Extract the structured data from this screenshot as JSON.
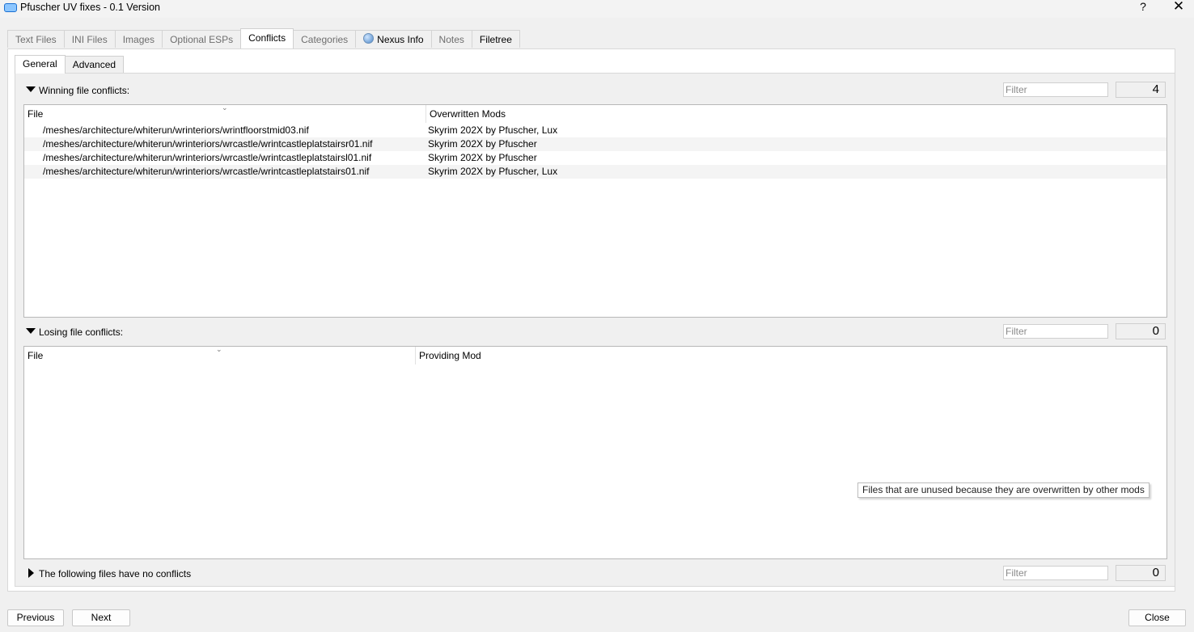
{
  "window": {
    "title": "Pfuscher UV fixes - 0.1 Version",
    "help_label": "?",
    "close_label": "✕"
  },
  "tabs": [
    {
      "label": "Text Files"
    },
    {
      "label": "INI Files"
    },
    {
      "label": "Images"
    },
    {
      "label": "Optional ESPs"
    },
    {
      "label": "Conflicts"
    },
    {
      "label": "Categories"
    },
    {
      "label": "Nexus Info",
      "icon": "globe-icon"
    },
    {
      "label": "Notes"
    },
    {
      "label": "Filetree"
    }
  ],
  "subtabs": [
    {
      "label": "General"
    },
    {
      "label": "Advanced"
    }
  ],
  "winning": {
    "header": "Winning file conflicts:",
    "filter_placeholder": "Filter",
    "count": "4",
    "columns": [
      "File",
      "Overwritten Mods"
    ],
    "rows": [
      {
        "file": "/meshes/architecture/whiterun/wrinteriors/wrintfloorstmid03.nif",
        "mods": "Skyrim 202X by Pfuscher, Lux"
      },
      {
        "file": "/meshes/architecture/whiterun/wrinteriors/wrcastle/wrintcastleplatstairsr01.nif",
        "mods": "Skyrim 202X by Pfuscher"
      },
      {
        "file": "/meshes/architecture/whiterun/wrinteriors/wrcastle/wrintcastleplatstairsl01.nif",
        "mods": "Skyrim 202X by Pfuscher"
      },
      {
        "file": "/meshes/architecture/whiterun/wrinteriors/wrcastle/wrintcastleplatstairs01.nif",
        "mods": "Skyrim 202X by Pfuscher, Lux"
      }
    ]
  },
  "losing": {
    "header": "Losing file conflicts:",
    "filter_placeholder": "Filter",
    "count": "0",
    "columns": [
      "File",
      "Providing Mod"
    ],
    "tooltip": "Files that are unused because they are overwritten by other mods"
  },
  "noconflict": {
    "header": "The following files have no conflicts",
    "filter_placeholder": "Filter",
    "count": "0"
  },
  "footer": {
    "previous": "Previous",
    "next": "Next",
    "close": "Close"
  }
}
